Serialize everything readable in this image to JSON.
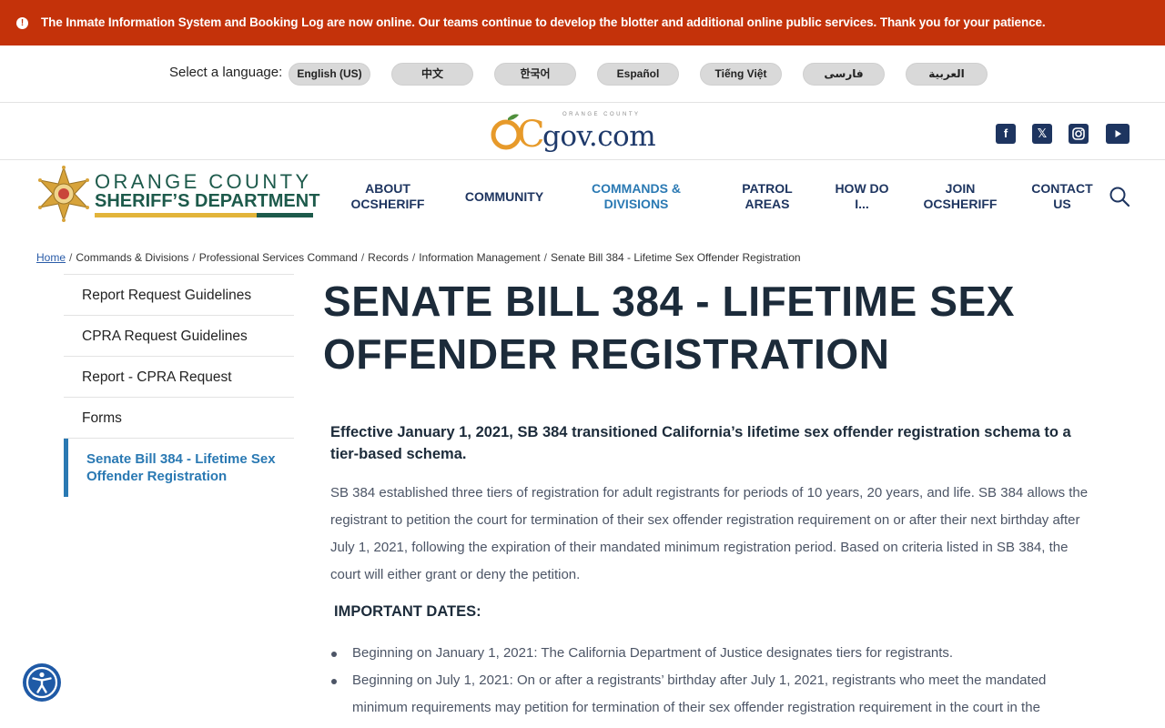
{
  "alert": {
    "icon": "alert-circle-icon",
    "text": "The Inmate Information System and Booking Log are now online. Our teams continue to develop the blotter and additional online public services. Thank you for your patience."
  },
  "language": {
    "label": "Select a language:",
    "options": [
      "English (US)",
      "中文",
      "한국어",
      "Español",
      "Tiếng Việt",
      "فارسی",
      "العربية"
    ]
  },
  "ocgov": {
    "tagline": "ORANGE COUNTY",
    "oc": "OC",
    "gov": "gov.com"
  },
  "social": [
    "facebook-icon",
    "x-icon",
    "instagram-icon",
    "youtube-icon"
  ],
  "sheriff": {
    "line1": "ORANGE COUNTY",
    "line2": "SHERIFF’S DEPARTMENT"
  },
  "nav": [
    {
      "label": "ABOUT OCSHERIFF"
    },
    {
      "label": "COMMUNITY"
    },
    {
      "label": "COMMANDS & DIVISIONS"
    },
    {
      "label": "PATROL AREAS"
    },
    {
      "label": "HOW DO I..."
    },
    {
      "label": "JOIN OCSHERIFF"
    },
    {
      "label": "CONTACT US"
    }
  ],
  "breadcrumb": [
    "Home",
    "Commands & Divisions",
    "Professional Services Command",
    "Records",
    "Information Management",
    "Senate Bill 384 - Lifetime Sex Offender Registration"
  ],
  "sidebar": [
    "Report Request Guidelines",
    "CPRA Request Guidelines",
    "Report - CPRA Request",
    "Forms",
    "Senate Bill 384 - Lifetime Sex Offender Registration"
  ],
  "content": {
    "title": "SENATE BILL 384 - LIFETIME SEX OFFENDER REGISTRATION",
    "lead": "Effective January 1, 2021, SB 384 transitioned California’s lifetime sex offender registration schema to a tier-based schema.",
    "body": "SB 384 established three tiers of registration for adult registrants for periods of 10 years, 20 years, and life. SB 384 allows the registrant to petition the court for termination of their sex offender registration requirement on or after their next birthday after July 1, 2021, following the expiration of their mandated minimum registration period. Based on criteria listed in SB 384, the court will either grant or deny the petition.",
    "subhead": "IMPORTANT DATES:",
    "dates": [
      "Beginning on January 1, 2021:  The California Department of Justice designates tiers for registrants.",
      "Beginning on July 1, 2021:  On or after a registrants’ birthday after July 1, 2021, registrants who meet the mandated minimum requirements may petition for termination of their sex offender registration requirement in the court in the"
    ]
  },
  "accessibility": {
    "icon": "accessibility-icon"
  }
}
